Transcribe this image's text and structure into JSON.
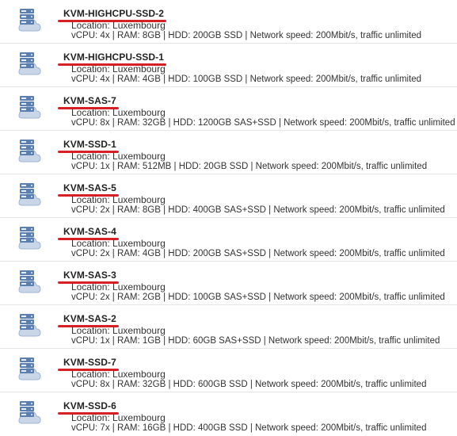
{
  "colors": {
    "underline": "#d81f26",
    "icon_primary": "#5b7fb0",
    "icon_light": "#c9d6e8"
  },
  "servers": [
    {
      "name": "KVM-HIGHCPU-SSD-2",
      "location": "Location: Luxembourg",
      "specs": "vCPU: 4x | RAM: 8GB | HDD: 200GB SSD | Network speed: 200Mbit/s, traffic unlimited",
      "icon": "server-cloud-icon"
    },
    {
      "name": "KVM-HIGHCPU-SSD-1",
      "location": "Location: Luxembourg",
      "specs": "vCPU: 4x | RAM: 4GB | HDD: 100GB SSD | Network speed: 200Mbit/s, traffic unlimited",
      "icon": "server-cloud-icon"
    },
    {
      "name": "KVM-SAS-7",
      "location": "Location: Luxembourg",
      "specs": "vCPU: 8x | RAM: 32GB | HDD: 1200GB SAS+SSD | Network speed: 200Mbit/s, traffic unlimited",
      "icon": "server-cloud-icon"
    },
    {
      "name": "KVM-SSD-1",
      "location": "Location: Luxembourg",
      "specs": "vCPU: 1x | RAM: 512MB | HDD: 20GB SSD | Network speed: 200Mbit/s, traffic unlimited",
      "icon": "server-cloud-icon"
    },
    {
      "name": "KVM-SAS-5",
      "location": "Location: Luxembourg",
      "specs": "vCPU: 2x | RAM: 8GB | HDD: 400GB SAS+SSD | Network speed: 200Mbit/s, traffic unlimited",
      "icon": "server-cloud-icon"
    },
    {
      "name": "KVM-SAS-4",
      "location": "Location: Luxembourg",
      "specs": "vCPU: 2x | RAM: 4GB | HDD: 200GB SAS+SSD | Network speed: 200Mbit/s, traffic unlimited",
      "icon": "server-cloud-icon"
    },
    {
      "name": "KVM-SAS-3",
      "location": "Location: Luxembourg",
      "specs": "vCPU: 2x | RAM: 2GB | HDD: 100GB SAS+SSD | Network speed: 200Mbit/s, traffic unlimited",
      "icon": "server-cloud-icon"
    },
    {
      "name": "KVM-SAS-2",
      "location": "Location: Luxembourg",
      "specs": "vCPU: 1x | RAM: 1GB | HDD: 60GB SAS+SSD | Network speed: 200Mbit/s, traffic unlimited",
      "icon": "server-cloud-icon"
    },
    {
      "name": "KVM-SSD-7",
      "location": "Location: Luxembourg",
      "specs": "vCPU: 8x | RAM: 32GB | HDD: 600GB SSD | Network speed: 200Mbit/s, traffic unlimited",
      "icon": "server-cloud-icon"
    },
    {
      "name": "KVM-SSD-6",
      "location": "Location: Luxembourg",
      "specs": "vCPU: 7x | RAM: 16GB | HDD: 400GB SSD | Network speed: 200Mbit/s, traffic unlimited",
      "icon": "server-cloud-icon"
    }
  ]
}
